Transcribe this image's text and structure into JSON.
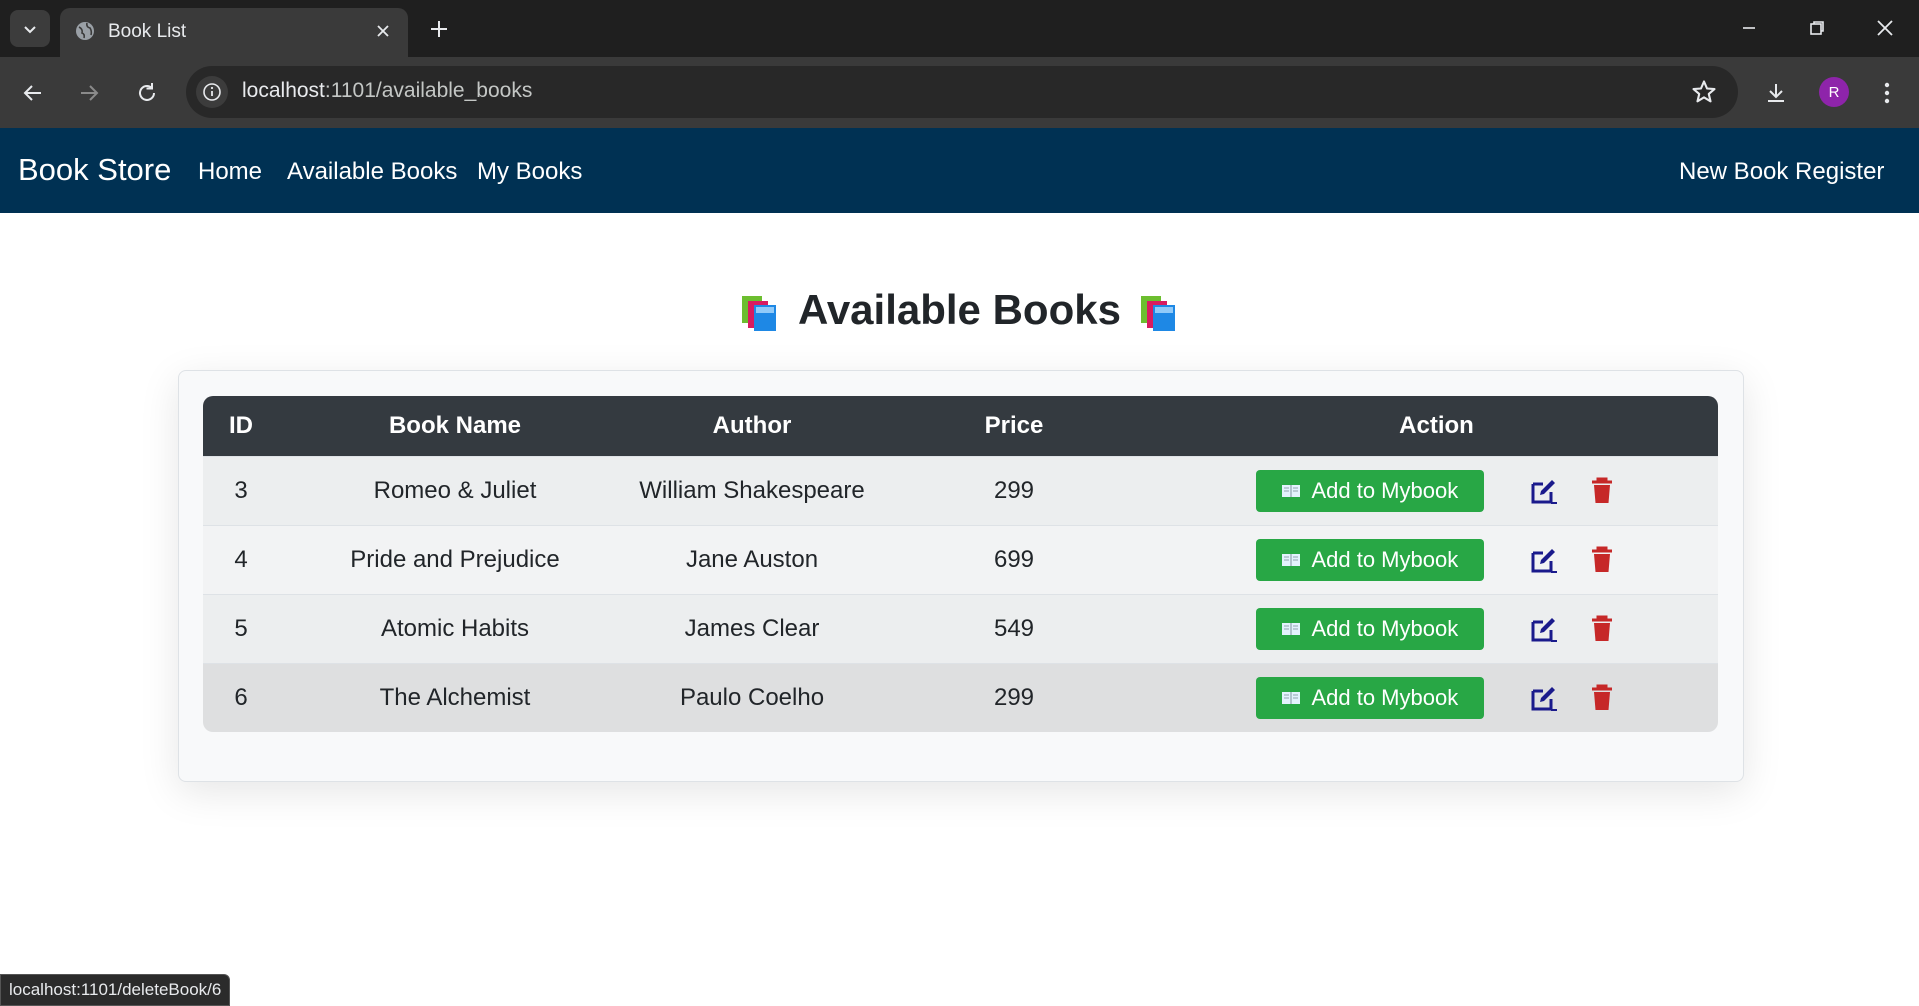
{
  "browser": {
    "tab_title": "Book List",
    "url_host": "localhost",
    "url_rest": ":1101/available_books",
    "profile_initial": "R",
    "status_url": "localhost:1101/deleteBook/6"
  },
  "navbar": {
    "brand": "Book Store",
    "links": [
      "Home",
      "Available Books",
      "My Books"
    ],
    "register": "New Book Register"
  },
  "page": {
    "heading": "Available Books"
  },
  "table": {
    "headers": {
      "id": "ID",
      "name": "Book Name",
      "author": "Author",
      "price": "Price",
      "action": "Action"
    },
    "add_label": "Add to Mybook",
    "rows": [
      {
        "id": "3",
        "name": "Romeo & Juliet",
        "author": "William Shakespeare",
        "price": "299"
      },
      {
        "id": "4",
        "name": "Pride and Prejudice",
        "author": "Jane Auston",
        "price": "699"
      },
      {
        "id": "5",
        "name": "Atomic Habits",
        "author": "James Clear",
        "price": "549"
      },
      {
        "id": "6",
        "name": "The Alchemist",
        "author": "Paulo Coelho",
        "price": "299"
      }
    ]
  },
  "colors": {
    "navbar": "#003153",
    "add_button": "#28a745",
    "edit_icon": "#1a1a8c",
    "delete_icon": "#c62828",
    "table_header": "#343a40"
  }
}
